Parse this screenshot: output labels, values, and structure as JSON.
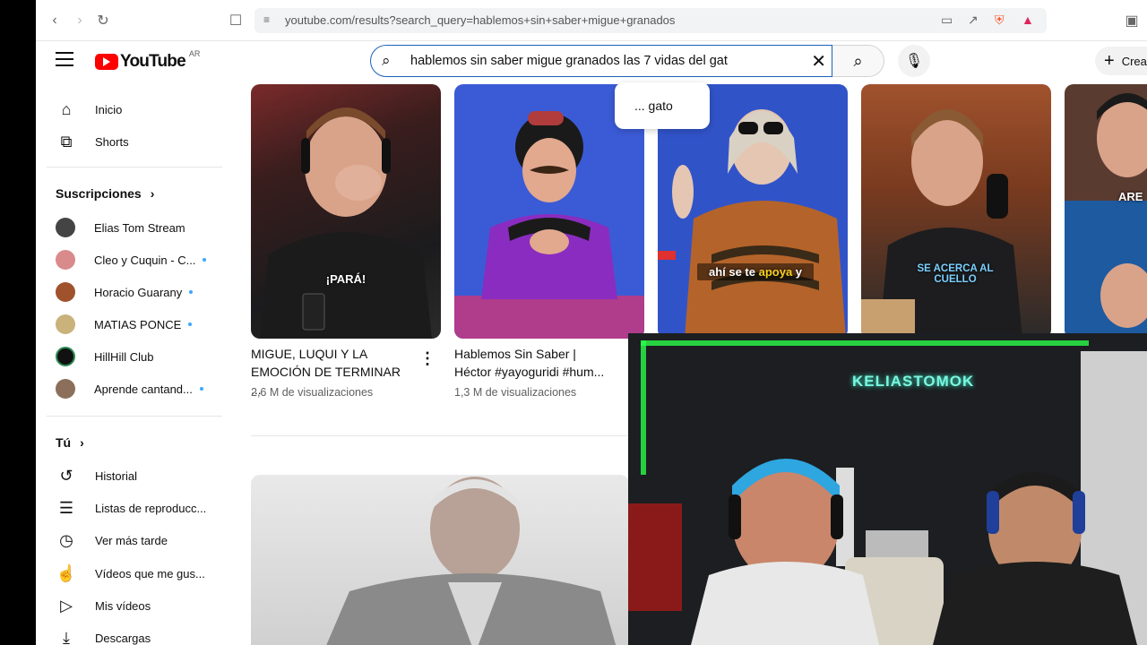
{
  "browser": {
    "url": "youtube.com/results?search_query=hablemos+sin+saber+migue+granados",
    "back_icon": "back-arrow-icon",
    "forward_icon": "forward-arrow-icon",
    "reload_icon": "reload-icon"
  },
  "masthead": {
    "logo_text": "YouTube",
    "country_code": "AR",
    "search_value": "hablemos sin saber migue granados las 7 vidas del gat",
    "suggestion": "... gato",
    "create_label": "Crea"
  },
  "sidebar": {
    "main": [
      {
        "label": "Inicio",
        "icon": "home-icon"
      },
      {
        "label": "Shorts",
        "icon": "shorts-icon"
      }
    ],
    "subscriptions_title": "Suscripciones",
    "subscriptions": [
      {
        "label": "Elias Tom Stream",
        "dot": false,
        "color": "#444444"
      },
      {
        "label": "Cleo y Cuquin - C...",
        "dot": true,
        "color": "#d98a8a"
      },
      {
        "label": "Horacio Guarany",
        "dot": true,
        "color": "#a0522d"
      },
      {
        "label": "MATIAS PONCE",
        "dot": true,
        "color": "#c9b37a"
      },
      {
        "label": "HillHill Club",
        "dot": false,
        "color": "#111111"
      },
      {
        "label": "Aprende cantand...",
        "dot": true,
        "color": "#8b6f5a"
      }
    ],
    "you_title": "Tú",
    "you_items": [
      {
        "label": "Historial",
        "icon": "history-icon"
      },
      {
        "label": "Listas de reproducc...",
        "icon": "playlist-icon"
      },
      {
        "label": "Ver más tarde",
        "icon": "clock-icon"
      },
      {
        "label": "Vídeos que me gus...",
        "icon": "thumbs-up-icon"
      },
      {
        "label": "Mis vídeos",
        "icon": "my-videos-icon"
      },
      {
        "label": "Descargas",
        "icon": "download-icon"
      }
    ]
  },
  "videos": [
    {
      "title_line1": "MIGUE, LUQUI Y LA",
      "title_line2": "EMOCIÓN DE TERMINAR ...",
      "views": "2,6 M de visualizaciones",
      "overlay": "¡PARÁ!"
    },
    {
      "title_line1": "Hablemos Sin Saber |",
      "title_line2": "Héctor #yayoguridi #hum...",
      "views": "1,3 M de visualizaciones",
      "overlay": ""
    },
    {
      "overlay_pre": "ahí se te ",
      "overlay_hl": "apoya",
      "overlay_post": " y"
    },
    {
      "overlay": "SE ACERCA AL CUELLO"
    },
    {
      "overlay": "ARE"
    }
  ],
  "webcam": {
    "neon_sign": "KELIASTOMOK"
  }
}
